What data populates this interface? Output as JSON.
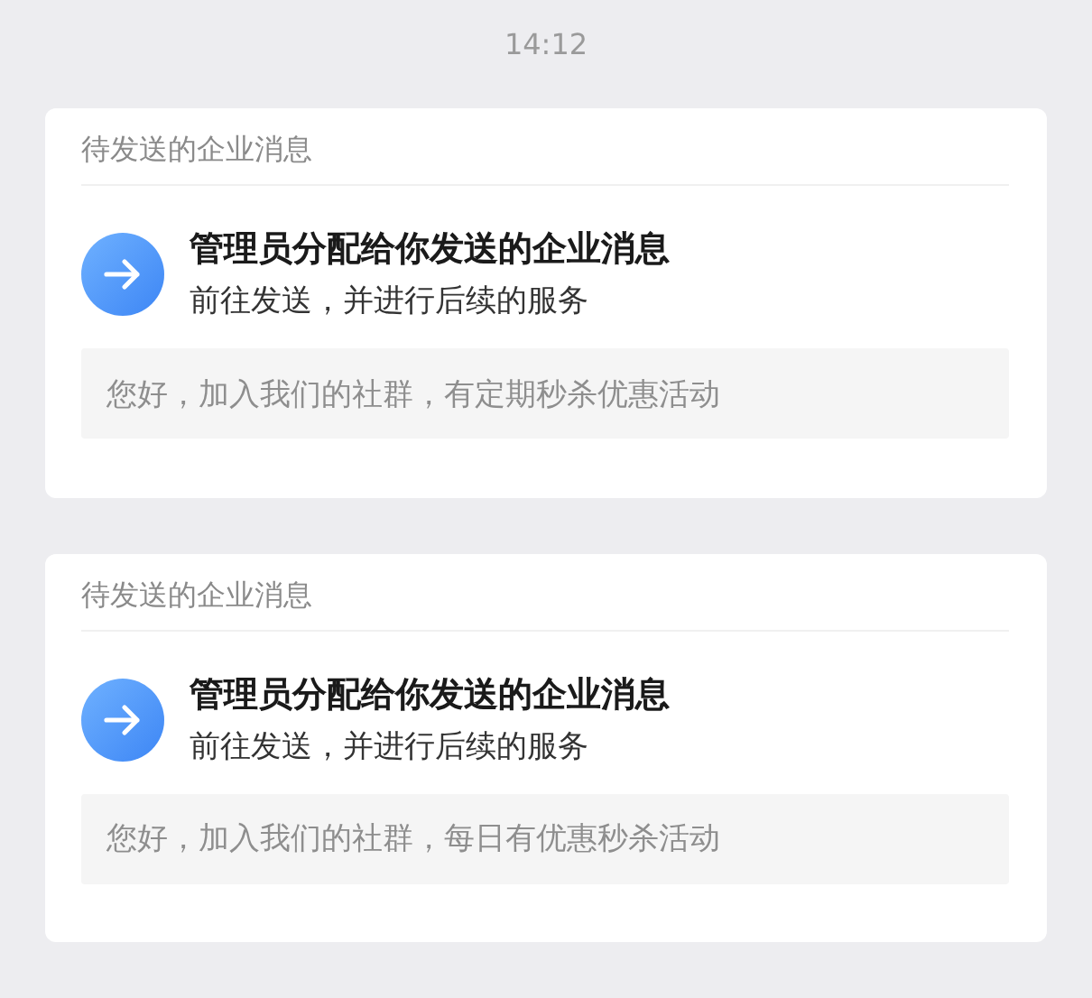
{
  "time": "14:12",
  "messages": [
    {
      "header": "待发送的企业消息",
      "title": "管理员分配给你发送的企业消息",
      "subtitle": "前往发送，并进行后续的服务",
      "content": "您好，加入我们的社群，有定期秒杀优惠活动"
    },
    {
      "header": "待发送的企业消息",
      "title": "管理员分配给你发送的企业消息",
      "subtitle": "前往发送，并进行后续的服务",
      "content": "您好，加入我们的社群，每日有优惠秒杀活动"
    }
  ]
}
